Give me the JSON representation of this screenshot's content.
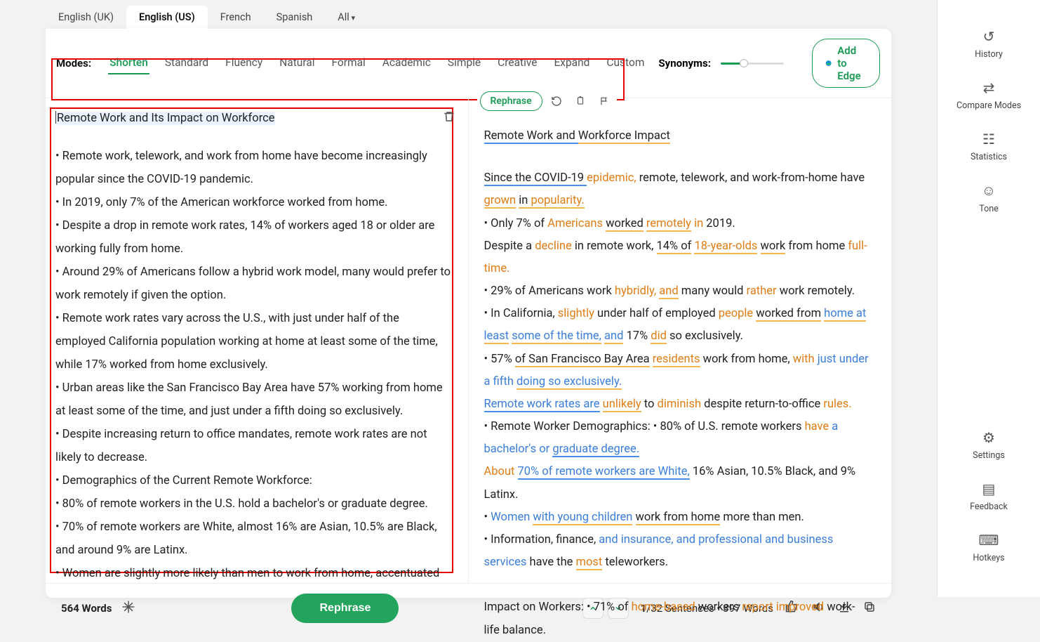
{
  "lang_tabs": [
    "English (UK)",
    "English (US)",
    "French",
    "Spanish",
    "All"
  ],
  "lang_active_index": 1,
  "modes_label": "Modes:",
  "modes": [
    "Shorten",
    "Standard",
    "Fluency",
    "Natural",
    "Formal",
    "Academic",
    "Simple",
    "Creative",
    "Expand",
    "Custom"
  ],
  "mode_active_index": 0,
  "synonyms_label": "Synonyms:",
  "edge_btn": "Add to Edge",
  "rephrase_pill": "Rephrase",
  "input_title": "Remote Work and Its Impact on Workforce",
  "input_body": "• Remote work, telework, and work from home have become increasingly popular since the COVID-19 pandemic.\n• In 2019, only 7% of the American workforce worked from home.\n• Despite a drop in remote work rates, 14% of workers aged 18 or older are working fully from home.\n• Around 29% of Americans follow a hybrid work model, many would prefer to work remotely if given the option.\n• Remote work rates vary across the U.S., with just under half of the employed California population working at home at least some of the time, while 17% worked from home exclusively.\n• Urban areas like the San Francisco Bay Area have 57% working from home at least some of the time, and just under a fifth doing so exclusively.\n• Despite increasing return to office mandates, remote work rates are not likely to decrease.\n• Demographics of the Current Remote Workforce:\n• 80% of remote workers in the U.S. hold a bachelor's or graduate degree.\n• 70% of remote workers are White, almost 16% are Asian, 10.5% are Black, and around 9% are Latinx.\n• Women are slightly more likely than men to work from home, accentuated",
  "output_title_runs": [
    {
      "t": "Remote Work and ",
      "cls": "u-b"
    },
    {
      "t": "Workforce Impact",
      "cls": "u-y"
    }
  ],
  "output_lines": [
    [
      {
        "t": "Since the COVID-19 ",
        "cls": "u-b"
      },
      {
        "t": "epidemic,",
        "cls": "c-o"
      },
      {
        "t": " remote, telework, and work-from-home have ",
        "cls": ""
      },
      {
        "t": "grown",
        "cls": "c-o u-y"
      },
      {
        "t": " ",
        "cls": ""
      },
      {
        "t": "in ",
        "cls": "u-y"
      },
      {
        "t": "popularity.",
        "cls": "c-o u-y"
      }
    ],
    [
      {
        "t": "• Only 7% of ",
        "cls": ""
      },
      {
        "t": "Americans",
        "cls": "c-o"
      },
      {
        "t": " ",
        "cls": ""
      },
      {
        "t": "worked",
        "cls": "u-y"
      },
      {
        "t": " ",
        "cls": ""
      },
      {
        "t": "remotely",
        "cls": "c-o u-y"
      },
      {
        "t": " ",
        "cls": ""
      },
      {
        "t": "in",
        "cls": "c-o"
      },
      {
        "t": " 2019.",
        "cls": ""
      }
    ],
    [
      {
        "t": "Despite a ",
        "cls": ""
      },
      {
        "t": "decline",
        "cls": "c-o"
      },
      {
        "t": " in remote work, ",
        "cls": ""
      },
      {
        "t": "14% of",
        "cls": "u-y"
      },
      {
        "t": " ",
        "cls": ""
      },
      {
        "t": "18-year-olds",
        "cls": "c-o u-y"
      },
      {
        "t": " ",
        "cls": ""
      },
      {
        "t": "work",
        "cls": "u-y"
      },
      {
        "t": " from home ",
        "cls": ""
      },
      {
        "t": "full-time.",
        "cls": "c-o"
      }
    ],
    [
      {
        "t": "• 29% of Americans work ",
        "cls": ""
      },
      {
        "t": "hybridly,",
        "cls": "c-o"
      },
      {
        "t": " ",
        "cls": ""
      },
      {
        "t": "and",
        "cls": "c-o u-y"
      },
      {
        "t": " many would ",
        "cls": ""
      },
      {
        "t": "rather",
        "cls": "c-o"
      },
      {
        "t": " work remotely.",
        "cls": ""
      }
    ],
    [
      {
        "t": "• In California, ",
        "cls": ""
      },
      {
        "t": "slightly",
        "cls": "c-o"
      },
      {
        "t": " under half of employed ",
        "cls": ""
      },
      {
        "t": "people",
        "cls": "c-o"
      },
      {
        "t": " ",
        "cls": ""
      },
      {
        "t": "worked from",
        "cls": "u-y"
      },
      {
        "t": " ",
        "cls": ""
      },
      {
        "t": "home at least",
        "cls": "c-b u-y"
      },
      {
        "t": " ",
        "cls": ""
      },
      {
        "t": "some of the time,",
        "cls": "c-b u-y"
      },
      {
        "t": " ",
        "cls": ""
      },
      {
        "t": "and",
        "cls": "c-b u-y"
      },
      {
        "t": " 17% ",
        "cls": ""
      },
      {
        "t": "did",
        "cls": "c-o u-y"
      },
      {
        "t": " so exclusively.",
        "cls": ""
      }
    ],
    [
      {
        "t": "• 57% ",
        "cls": ""
      },
      {
        "t": "of San Francisco Bay Area",
        "cls": "u-y"
      },
      {
        "t": " ",
        "cls": ""
      },
      {
        "t": "residents",
        "cls": "c-o u-y"
      },
      {
        "t": " work from home, ",
        "cls": ""
      },
      {
        "t": "with",
        "cls": "c-o"
      },
      {
        "t": " ",
        "cls": ""
      },
      {
        "t": "just under a fifth",
        "cls": "c-b"
      },
      {
        "t": " ",
        "cls": ""
      },
      {
        "t": "doing so exclusively.",
        "cls": "c-b u-y"
      }
    ],
    [
      {
        "t": "Remote work rates are",
        "cls": "c-b u-b"
      },
      {
        "t": " ",
        "cls": ""
      },
      {
        "t": "unlikely",
        "cls": "c-o u-y"
      },
      {
        "t": " to ",
        "cls": ""
      },
      {
        "t": "diminish",
        "cls": "c-o"
      },
      {
        "t": " despite return-to-office ",
        "cls": ""
      },
      {
        "t": "rules.",
        "cls": "c-o"
      }
    ],
    [
      {
        "t": "• Remote Worker Demographics: • 80% of U.S. remote workers ",
        "cls": ""
      },
      {
        "t": "have",
        "cls": "c-o"
      },
      {
        "t": " ",
        "cls": ""
      },
      {
        "t": "a bachelor's or",
        "cls": "c-b"
      },
      {
        "t": " ",
        "cls": ""
      },
      {
        "t": "graduate degree.",
        "cls": "c-b u-b"
      }
    ],
    [
      {
        "t": "About",
        "cls": "c-o"
      },
      {
        "t": " ",
        "cls": ""
      },
      {
        "t": "70% of remote workers are White,",
        "cls": "c-b u-b"
      },
      {
        "t": " 16% Asian, 10.5% Black, and 9% Latinx.",
        "cls": ""
      }
    ],
    [
      {
        "t": "• ",
        "cls": ""
      },
      {
        "t": "Women",
        "cls": "c-b"
      },
      {
        "t": " ",
        "cls": ""
      },
      {
        "t": "with young children",
        "cls": "c-b u-y"
      },
      {
        "t": " ",
        "cls": ""
      },
      {
        "t": "work from home",
        "cls": "u-y"
      },
      {
        "t": " more than men.",
        "cls": ""
      }
    ],
    [
      {
        "t": "• Information, finance, ",
        "cls": ""
      },
      {
        "t": "and insurance, and professional and business services",
        "cls": "c-b"
      },
      {
        "t": " have the ",
        "cls": ""
      },
      {
        "t": "most",
        "cls": "c-o u-y"
      },
      {
        "t": " teleworkers.",
        "cls": ""
      }
    ],
    [
      {
        "t": "",
        "cls": ""
      }
    ],
    [
      {
        "t": "Impact on Workers: • 71% of ",
        "cls": ""
      },
      {
        "t": "home-based",
        "cls": "c-o"
      },
      {
        "t": " workers ",
        "cls": ""
      },
      {
        "t": "report improved",
        "cls": "c-o"
      },
      {
        "t": " work-life balance.",
        "cls": ""
      }
    ]
  ],
  "bottom": {
    "left_count": "564 Words",
    "rephrase_btn": "Rephrase",
    "sentence_pos": "1",
    "sentence_total": "/32 Sentences  •  397 Words"
  },
  "rail": {
    "top": [
      "History",
      "Compare Modes",
      "Statistics",
      "Tone"
    ],
    "bottom": [
      "Settings",
      "Feedback",
      "Hotkeys"
    ]
  }
}
